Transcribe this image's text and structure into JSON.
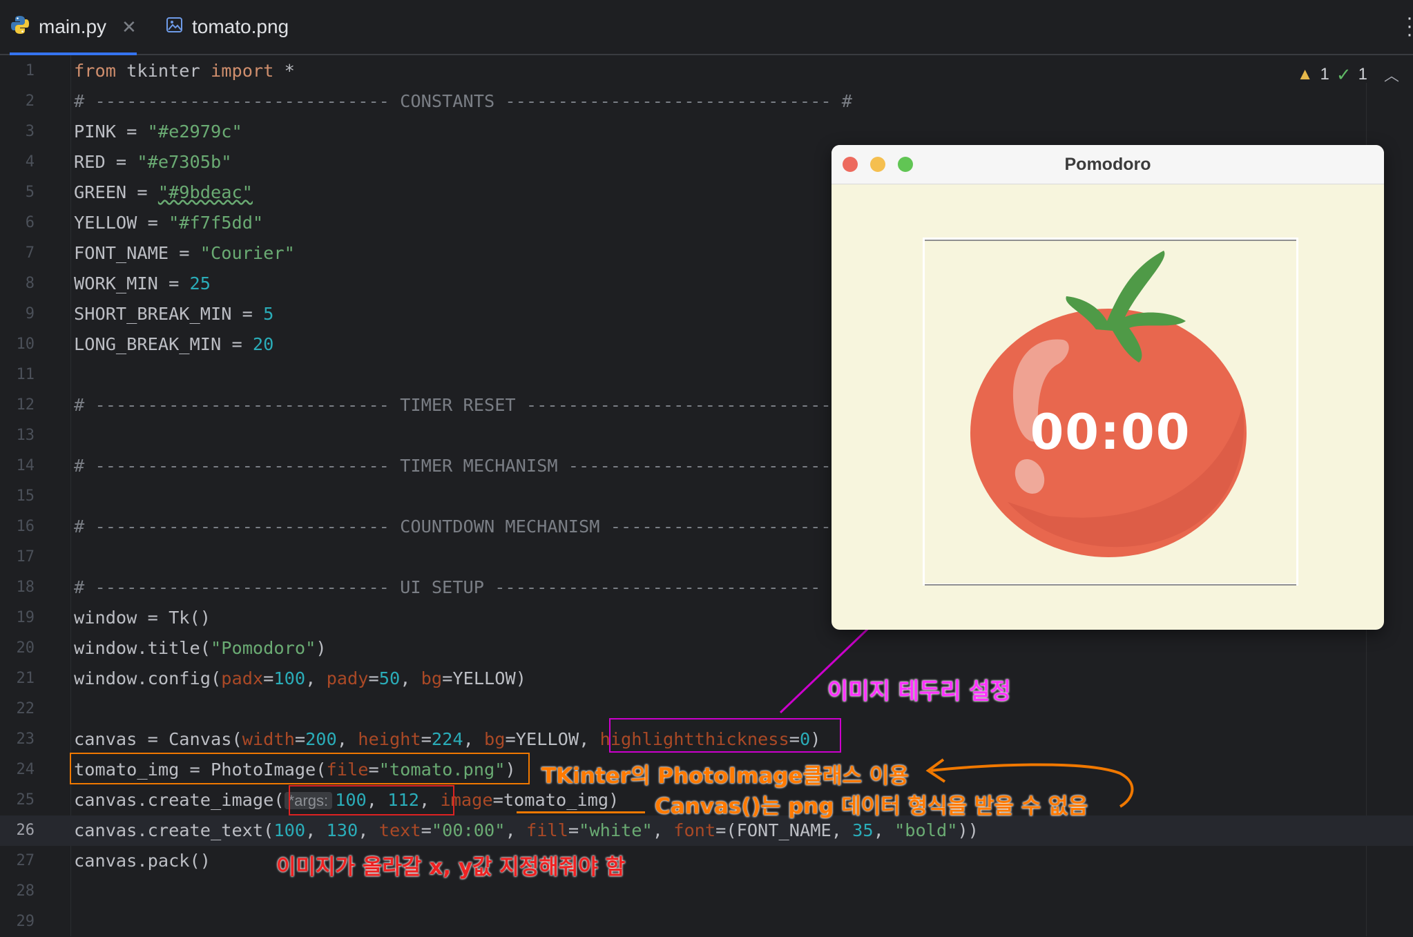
{
  "tabs": [
    {
      "label": "main.py",
      "icon": "python-file-icon",
      "active": true
    },
    {
      "label": "tomato.png",
      "icon": "image-file-icon",
      "active": false
    }
  ],
  "inspections": {
    "warnings": "1",
    "ok": "1"
  },
  "current_line": "26",
  "lines": [
    {
      "n": "1"
    },
    {
      "n": "2"
    },
    {
      "n": "3"
    },
    {
      "n": "4"
    },
    {
      "n": "5"
    },
    {
      "n": "6"
    },
    {
      "n": "7"
    },
    {
      "n": "8"
    },
    {
      "n": "9"
    },
    {
      "n": "10"
    },
    {
      "n": "11"
    },
    {
      "n": "12"
    },
    {
      "n": "13"
    },
    {
      "n": "14"
    },
    {
      "n": "15"
    },
    {
      "n": "16"
    },
    {
      "n": "17"
    },
    {
      "n": "18"
    },
    {
      "n": "19"
    },
    {
      "n": "20"
    },
    {
      "n": "21"
    },
    {
      "n": "22"
    },
    {
      "n": "23"
    },
    {
      "n": "24"
    },
    {
      "n": "25"
    },
    {
      "n": "26"
    },
    {
      "n": "27"
    },
    {
      "n": "28"
    },
    {
      "n": "29"
    }
  ],
  "code": {
    "l1": [
      "from",
      " tkinter ",
      "import",
      " *"
    ],
    "l2": "# ---------------------------- CONSTANTS ------------------------------- #",
    "l3": [
      "PINK = ",
      "\"#e2979c\""
    ],
    "l4": [
      "RED = ",
      "\"#e7305b\""
    ],
    "l5": [
      "GREEN = ",
      "\"#9bdeac\""
    ],
    "l6": [
      "YELLOW = ",
      "\"#f7f5dd\""
    ],
    "l7": [
      "FONT_NAME = ",
      "\"Courier\""
    ],
    "l8": [
      "WORK_MIN = ",
      "25"
    ],
    "l9": [
      "SHORT_BREAK_MIN = ",
      "5"
    ],
    "l10": [
      "LONG_BREAK_MIN = ",
      "20"
    ],
    "l12": "# ---------------------------- TIMER RESET -------------------------------",
    "l14": "# ---------------------------- TIMER MECHANISM -------------------------------",
    "l16": "# ---------------------------- COUNTDOWN MECHANISM -------------------------------",
    "l18": "# ---------------------------- UI SETUP -------------------------------",
    "l19": "window = Tk()",
    "l20": [
      "window.title(",
      "\"Pomodoro\"",
      ")"
    ],
    "l21": [
      "window.config(",
      "padx",
      "=",
      "100",
      ", ",
      "pady",
      "=",
      "50",
      ", ",
      "bg",
      "=YELLOW)"
    ],
    "l23": [
      "canvas = Canvas(",
      "width",
      "=",
      "200",
      ", ",
      "height",
      "=",
      "224",
      ", ",
      "bg",
      "=YELLOW, ",
      "highlightthickness",
      "=",
      "0",
      ")"
    ],
    "l24": [
      "tomato_img = PhotoImage(",
      "file",
      "=",
      "\"tomato.png\"",
      ")"
    ],
    "l25": [
      "canvas.create_image(",
      "*args:",
      "100",
      ", ",
      "112",
      ", ",
      "image",
      "=tomato_img)"
    ],
    "l26": [
      "canvas.create_text(",
      "100",
      ", ",
      "130",
      ", ",
      "text",
      "=",
      "\"00:00\"",
      ", ",
      "fill",
      "=",
      "\"white\"",
      ", ",
      "font",
      "=(FONT_NAME, ",
      "35",
      ", ",
      "\"bold\"",
      "))"
    ],
    "l27": "canvas.pack()"
  },
  "window": {
    "title": "Pomodoro",
    "timer_text": "00:00",
    "background": "#f7f5dd"
  },
  "annotations": {
    "border": "이미지 테두리 설정",
    "photoimage": "TKinter의 PhotoImage클래스 이용",
    "canvas_png": "Canvas()는 png 데이터 형식을 받을 수 없음",
    "xy": "이미지가 올라갈 x, y값 지정해줘야 함"
  },
  "colors": {
    "editor_bg": "#1e1f22",
    "tomato_red": "#e56d50",
    "leaf_green": "#4f9a47",
    "annotation_magenta": "#cc00cc",
    "annotation_orange": "#f07800",
    "annotation_red": "#dd2222"
  }
}
